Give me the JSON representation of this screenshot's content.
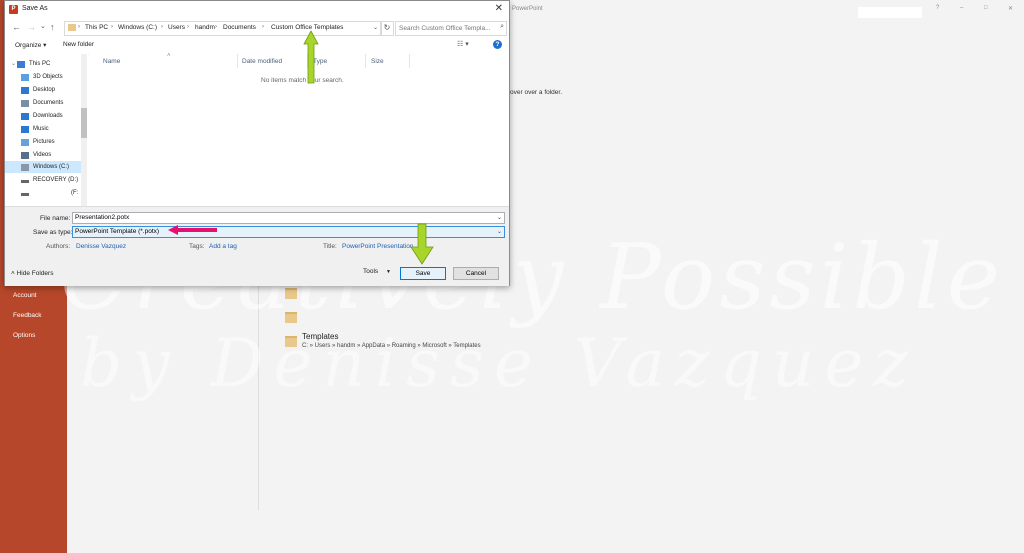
{
  "background": {
    "app_title": "PowerPoint",
    "window_buttons": [
      "?",
      "–",
      "□",
      "✕"
    ],
    "nav_items": [
      "Account",
      "Feedback",
      "Options"
    ],
    "hover_hint": "over over a folder.",
    "templates_folder": {
      "name": "Templates",
      "path": "C: » Users » handm » AppData » Roaming » Microsoft » Templates"
    },
    "watermark_line1": "Creatively Possible",
    "watermark_line2": "by Denisse Vazquez",
    "accent_color": "#b7472a"
  },
  "dialog": {
    "title": "Save As",
    "close": "✕",
    "nav": {
      "back": "←",
      "forward": "→",
      "up_dropdown": "⌄",
      "up": "↑"
    },
    "breadcrumbs": [
      "This PC",
      "Windows (C:)",
      "Users",
      "handm",
      "Documents",
      "Custom Office Templates"
    ],
    "breadcrumb_sep": "›",
    "search_placeholder": "Search Custom Office Templa...",
    "toolbar": {
      "organize": "Organize ▾",
      "new_folder": "New folder",
      "view": "☷ ▾",
      "help": "?"
    },
    "nav_pane": [
      {
        "label": "This PC",
        "icon": "computer-icon",
        "color": "#3a7bd5"
      },
      {
        "label": "3D Objects",
        "icon": "cube-icon",
        "color": "#5aa0e0"
      },
      {
        "label": "Desktop",
        "icon": "desktop-icon",
        "color": "#2b78d0"
      },
      {
        "label": "Documents",
        "icon": "document-icon",
        "color": "#7a8ea8"
      },
      {
        "label": "Downloads",
        "icon": "download-icon",
        "color": "#2b78d0"
      },
      {
        "label": "Music",
        "icon": "music-icon",
        "color": "#2b78d0"
      },
      {
        "label": "Pictures",
        "icon": "pictures-icon",
        "color": "#6aa0d8"
      },
      {
        "label": "Videos",
        "icon": "video-icon",
        "color": "#5a6f8a"
      },
      {
        "label": "Windows (C:)",
        "icon": "drive-icon",
        "color": "#8a97a8"
      },
      {
        "label": "RECOVERY (D:)",
        "icon": "drive-icon",
        "color": "#666666"
      },
      {
        "label": "(F:",
        "icon": "drive-icon",
        "color": "#666666"
      }
    ],
    "columns": [
      "Name",
      "Date modified",
      "Type",
      "Size"
    ],
    "sort_indicator": "˄",
    "empty_message": "No items match your search.",
    "file_name_label": "File name:",
    "file_name_value": "Presentation2.potx",
    "save_type_label": "Save as type:",
    "save_type_value": "PowerPoint Template (*.potx)",
    "authors_label": "Authors:",
    "authors_value": "Denisse Vazquez",
    "tags_label": "Tags:",
    "tags_value": "Add a tag",
    "title_label": "Title:",
    "title_value": "PowerPoint Presentation",
    "hide_folders": "Hide Folders",
    "tools": "Tools",
    "save": "Save",
    "cancel": "Cancel"
  },
  "annotations": {
    "arrow_color": "#a8d52a",
    "pink_arrow_color": "#e8106e"
  }
}
